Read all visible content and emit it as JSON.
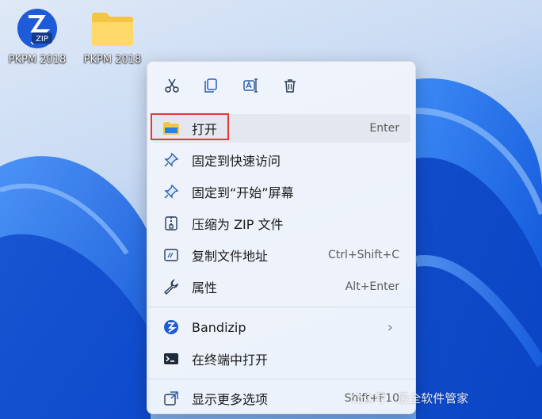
{
  "desktop": {
    "icons": [
      {
        "label": "PKPM 2018",
        "icon": "zip-archive-icon",
        "badge": "ZIP"
      },
      {
        "label": "PKPM 2018",
        "icon": "folder-icon"
      }
    ]
  },
  "context_menu": {
    "toolbar": [
      {
        "name": "cut",
        "icon": "scissors-icon"
      },
      {
        "name": "copy",
        "icon": "copy-icon"
      },
      {
        "name": "rename",
        "icon": "rename-icon"
      },
      {
        "name": "delete",
        "icon": "trash-icon"
      }
    ],
    "items": [
      {
        "label": "打开",
        "shortcut": "Enter",
        "icon": "folder-open-icon"
      },
      {
        "label": "固定到快速访问",
        "icon": "pin-icon"
      },
      {
        "label": "固定到“开始”屏幕",
        "icon": "pin-icon"
      },
      {
        "label": "压缩为 ZIP 文件",
        "icon": "zip-file-icon"
      },
      {
        "label": "复制文件地址",
        "shortcut": "Ctrl+Shift+C",
        "icon": "path-icon"
      },
      {
        "label": "属性",
        "shortcut": "Alt+Enter",
        "icon": "wrench-icon"
      },
      {
        "label": "Bandizip",
        "icon": "bandizip-icon",
        "has_submenu": true,
        "chevron": "›"
      },
      {
        "label": "在终端中打开",
        "icon": "terminal-icon"
      },
      {
        "label": "显示更多选项",
        "shortcut": "Shift+F10",
        "icon": "more-options-icon"
      }
    ]
  },
  "watermark": "公众号 · 最全软件管家",
  "colors": {
    "highlight_border": "#e53935",
    "menu_bg": "#f0f4fb",
    "accent": "#1a73e8"
  }
}
